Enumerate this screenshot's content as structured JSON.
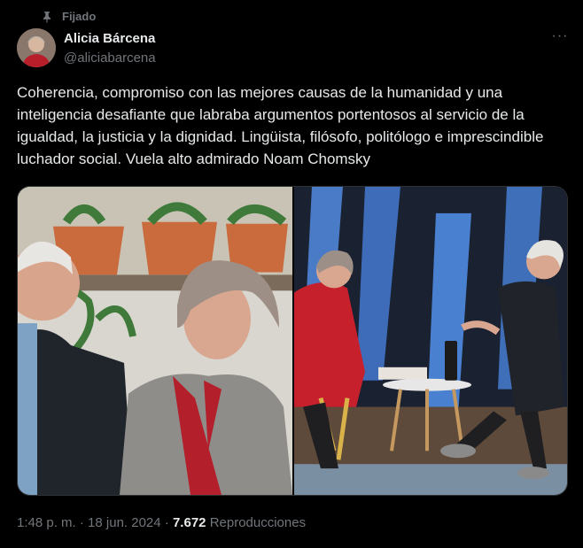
{
  "pinned_label": "Fijado",
  "author": {
    "name": "Alicia Bárcena",
    "handle": "@aliciabarcena"
  },
  "tweet_text": "Coherencia, compromiso con las mejores causas de la humanidad y una inteligencia desafiante que labraba argumentos portentosos al servicio de la igualdad, la justicia y la dignidad. Lingüista, filósofo, politólogo e imprescindible luchador social. Vuela alto admirado Noam Chomsky",
  "more_label": "···",
  "meta": {
    "time": "1:48 p. m.",
    "separator": "·",
    "date": "18 jun. 2024",
    "views_count": "7.672",
    "views_label": "Reproducciones"
  },
  "icons": {
    "pin": "pin-icon",
    "more": "more-icon"
  },
  "colors": {
    "background": "#000000",
    "text": "#e7e9ea",
    "secondary": "#71767b",
    "border": "#2f3336"
  }
}
